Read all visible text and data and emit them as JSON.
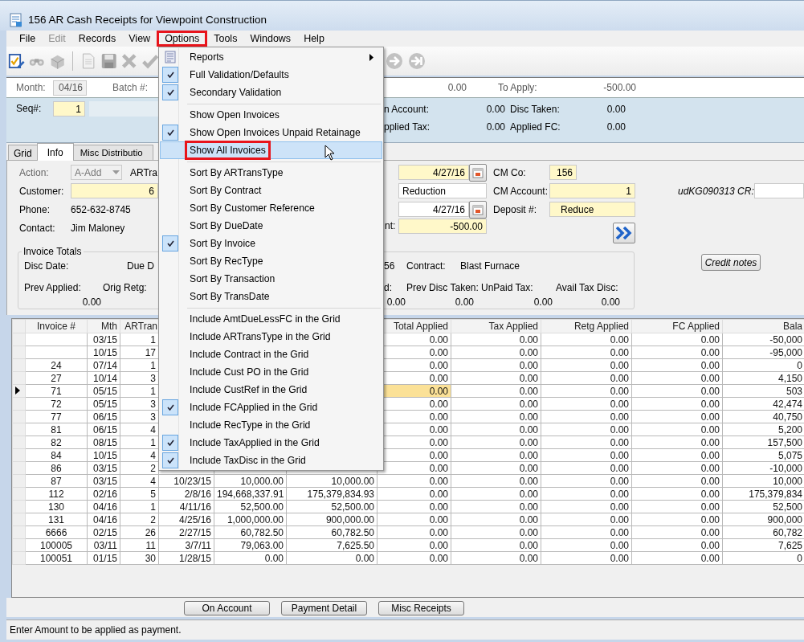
{
  "window": {
    "title": "156 AR Cash Receipts for Viewpoint Construction"
  },
  "menu_bar": [
    {
      "label": "File",
      "disabled": false,
      "highlighted": false
    },
    {
      "label": "Edit",
      "disabled": true,
      "highlighted": false
    },
    {
      "label": "Records",
      "disabled": false,
      "highlighted": false
    },
    {
      "label": "View",
      "disabled": false,
      "highlighted": false
    },
    {
      "label": "Options",
      "disabled": false,
      "highlighted": true
    },
    {
      "label": "Tools",
      "disabled": false,
      "highlighted": false
    },
    {
      "label": "Windows",
      "disabled": false,
      "highlighted": false
    },
    {
      "label": "Help",
      "disabled": false,
      "highlighted": false
    }
  ],
  "options_menu": {
    "items": [
      {
        "kind": "submenu",
        "label": "Reports",
        "checked": false,
        "hovered": false,
        "highlighted": false
      },
      {
        "kind": "option",
        "label": "Full Validation/Defaults",
        "checked": true,
        "hovered": false,
        "highlighted": false
      },
      {
        "kind": "option",
        "label": "Secondary Validation",
        "checked": true,
        "hovered": false,
        "highlighted": false
      },
      {
        "kind": "separator"
      },
      {
        "kind": "option",
        "label": "Show Open Invoices",
        "checked": false,
        "hovered": false,
        "highlighted": false
      },
      {
        "kind": "option",
        "label": "Show Open Invoices  Unpaid Retainage",
        "checked": true,
        "hovered": false,
        "highlighted": false
      },
      {
        "kind": "option",
        "label": "Show All Invoices",
        "checked": false,
        "hovered": true,
        "highlighted": true
      },
      {
        "kind": "separator"
      },
      {
        "kind": "option",
        "label": "Sort By ARTransType",
        "checked": false,
        "hovered": false,
        "highlighted": false
      },
      {
        "kind": "option",
        "label": "Sort By Contract",
        "checked": false,
        "hovered": false,
        "highlighted": false
      },
      {
        "kind": "option",
        "label": "Sort By Customer Reference",
        "checked": false,
        "hovered": false,
        "highlighted": false
      },
      {
        "kind": "option",
        "label": "Sort By DueDate",
        "checked": false,
        "hovered": false,
        "highlighted": false
      },
      {
        "kind": "option",
        "label": "Sort By Invoice",
        "checked": true,
        "hovered": false,
        "highlighted": false
      },
      {
        "kind": "option",
        "label": "Sort By RecType",
        "checked": false,
        "hovered": false,
        "highlighted": false
      },
      {
        "kind": "option",
        "label": "Sort By Transaction",
        "checked": false,
        "hovered": false,
        "highlighted": false
      },
      {
        "kind": "option",
        "label": "Sort By TransDate",
        "checked": false,
        "hovered": false,
        "highlighted": false
      },
      {
        "kind": "separator"
      },
      {
        "kind": "option",
        "label": "Include AmtDueLessFC in the Grid",
        "checked": false,
        "hovered": false,
        "highlighted": false
      },
      {
        "kind": "option",
        "label": "Include ARTransType in the Grid",
        "checked": false,
        "hovered": false,
        "highlighted": false
      },
      {
        "kind": "option",
        "label": "Include Contract in the Grid",
        "checked": false,
        "hovered": false,
        "highlighted": false
      },
      {
        "kind": "option",
        "label": "Include Cust PO in the Grid",
        "checked": false,
        "hovered": false,
        "highlighted": false
      },
      {
        "kind": "option",
        "label": "Include CustRef in the Grid",
        "checked": false,
        "hovered": false,
        "highlighted": false
      },
      {
        "kind": "option",
        "label": "Include FCApplied in the Grid",
        "checked": true,
        "hovered": false,
        "highlighted": false
      },
      {
        "kind": "option",
        "label": "Include RecType in the Grid",
        "checked": false,
        "hovered": false,
        "highlighted": false
      },
      {
        "kind": "option",
        "label": "Include TaxApplied in the Grid",
        "checked": true,
        "hovered": false,
        "highlighted": false
      },
      {
        "kind": "option",
        "label": "Include TaxDisc in the Grid",
        "checked": true,
        "hovered": false,
        "highlighted": false
      }
    ]
  },
  "batch_header": {
    "month_label": "Month:",
    "month": "04/16",
    "batch_label": "Batch #:",
    "amount": "0.00",
    "to_apply_label": "To Apply:",
    "to_apply": "-500.00"
  },
  "summary": {
    "seq_label": "Seq#:",
    "seq": "1",
    "totals": [
      {
        "label": "n Account:",
        "value": "0.00"
      },
      {
        "label": "Disc Taken:",
        "value": "0.00"
      },
      {
        "label": "pplied Tax:",
        "value": "0.00"
      },
      {
        "label": "Applied FC:",
        "value": "0.00"
      }
    ]
  },
  "tabs": [
    {
      "label": "Grid",
      "selected": false
    },
    {
      "label": "Info",
      "selected": true
    },
    {
      "label": "Misc Distributio",
      "selected": false
    }
  ],
  "info": {
    "action_label": "Action:",
    "action": "A-Add",
    "artrans_label": "ARTra",
    "customer_label": "Customer:",
    "customer": "6",
    "phone_label": "Phone:",
    "phone": "652-632-8745",
    "contact_label": "Contact:",
    "contact": "Jim Maloney",
    "date_1": "4/27/16",
    "description": "Reduction",
    "date_2": "4/27/16",
    "amount_label": "nt:",
    "amount": "-500.00",
    "cm_co_label": "CM Co:",
    "cm_co": "156",
    "cm_account_label": "CM Account:",
    "cm_account": "1",
    "deposit_label": "Deposit #:",
    "deposit": "Reduce",
    "ud_label": "udKG090313 CR:"
  },
  "invoice_totals": {
    "title": "Invoice Totals",
    "disc_date_label": "Disc Date:",
    "due_date_label": "Due D",
    "prev_applied_label": "Prev Applied:",
    "orig_retg_label": "Orig Retg:",
    "prev_applied": "0.00",
    "customer_tail": "56",
    "contract_label": "Contract:",
    "contract": "Blast Furnace",
    "label_tail": "d:",
    "prev_disc_label": "Prev Disc Taken:",
    "unpaid_tax_label": "UnPaid Tax:",
    "avail_tax_disc_label": "Avail Tax Disc:",
    "values": [
      "0.00",
      "0.00",
      "0.00",
      "0.00"
    ]
  },
  "credit_notes_button": "Credit notes",
  "grid": {
    "columns": [
      "Invoice #",
      "Mth",
      "ARTran",
      null,
      null,
      null,
      "Total Applied",
      "Tax Applied",
      "Retg Applied",
      "FC Applied",
      "Bala"
    ],
    "rows": [
      {
        "current": false,
        "cells": [
          null,
          "03/15",
          "1",
          null,
          null,
          null,
          "0.00",
          "0.00",
          "0.00",
          "0.00",
          "-50,000"
        ]
      },
      {
        "current": false,
        "cells": [
          null,
          "10/15",
          "17",
          null,
          null,
          null,
          "0.00",
          "0.00",
          "0.00",
          "0.00",
          "-95,000"
        ]
      },
      {
        "current": false,
        "cells": [
          "24",
          "07/14",
          "1",
          null,
          null,
          null,
          "0.00",
          "0.00",
          "0.00",
          "0.00",
          "0"
        ]
      },
      {
        "current": false,
        "cells": [
          "27",
          "10/14",
          "3",
          null,
          null,
          null,
          "0.00",
          "0.00",
          "0.00",
          "0.00",
          "4,150"
        ]
      },
      {
        "current": true,
        "cells": [
          "71",
          "05/15",
          "1",
          null,
          null,
          null,
          "0.00",
          "0.00",
          "0.00",
          "0.00",
          "503"
        ]
      },
      {
        "current": false,
        "cells": [
          "72",
          "05/15",
          "3",
          null,
          null,
          null,
          "0.00",
          "0.00",
          "0.00",
          "0.00",
          "42,474"
        ]
      },
      {
        "current": false,
        "cells": [
          "77",
          "06/15",
          "3",
          null,
          null,
          null,
          "0.00",
          "0.00",
          "0.00",
          "0.00",
          "40,750"
        ]
      },
      {
        "current": false,
        "cells": [
          "81",
          "06/15",
          "4",
          null,
          null,
          null,
          "0.00",
          "0.00",
          "0.00",
          "0.00",
          "5,200"
        ]
      },
      {
        "current": false,
        "cells": [
          "82",
          "08/15",
          "1",
          null,
          null,
          null,
          "0.00",
          "0.00",
          "0.00",
          "0.00",
          "157,500"
        ]
      },
      {
        "current": false,
        "cells": [
          "84",
          "10/15",
          "4",
          null,
          null,
          null,
          "0.00",
          "0.00",
          "0.00",
          "0.00",
          "5,075"
        ]
      },
      {
        "current": false,
        "cells": [
          "86",
          "03/15",
          "2",
          null,
          null,
          null,
          "0.00",
          "0.00",
          "0.00",
          "0.00",
          "-10,000"
        ]
      },
      {
        "current": false,
        "cells": [
          "87",
          "03/15",
          "4",
          "10/23/15",
          "10,000.00",
          "10,000.00",
          "0.00",
          "0.00",
          "0.00",
          "0.00",
          "10,000"
        ]
      },
      {
        "current": false,
        "cells": [
          "112",
          "02/16",
          "5",
          "2/8/16",
          "194,668,337.91",
          "175,379,834.93",
          "0.00",
          "0.00",
          "0.00",
          "0.00",
          "175,379,834"
        ]
      },
      {
        "current": false,
        "cells": [
          "130",
          "04/16",
          "1",
          "4/11/16",
          "52,500.00",
          "52,500.00",
          "0.00",
          "0.00",
          "0.00",
          "0.00",
          "52,500"
        ]
      },
      {
        "current": false,
        "cells": [
          "131",
          "04/16",
          "2",
          "4/25/16",
          "1,000,000.00",
          "900,000.00",
          "0.00",
          "0.00",
          "0.00",
          "0.00",
          "900,000"
        ]
      },
      {
        "current": false,
        "cells": [
          "6666",
          "02/15",
          "26",
          "2/27/15",
          "60,782.50",
          "60,782.50",
          "0.00",
          "0.00",
          "0.00",
          "0.00",
          "60,782"
        ]
      },
      {
        "current": false,
        "cells": [
          "100005",
          "03/11",
          "11",
          "3/7/11",
          "79,063.00",
          "7,625.50",
          "0.00",
          "0.00",
          "0.00",
          "0.00",
          "7,625"
        ]
      },
      {
        "current": false,
        "cells": [
          "100051",
          "01/15",
          "30",
          "1/28/15",
          "0.00",
          "0.00",
          "0.00",
          "0.00",
          "0.00",
          "0.00",
          "0"
        ]
      }
    ]
  },
  "buttons": [
    "On Account",
    "Payment Detail",
    "Misc Receipts"
  ],
  "status_bar": "Enter Amount to be applied as payment."
}
